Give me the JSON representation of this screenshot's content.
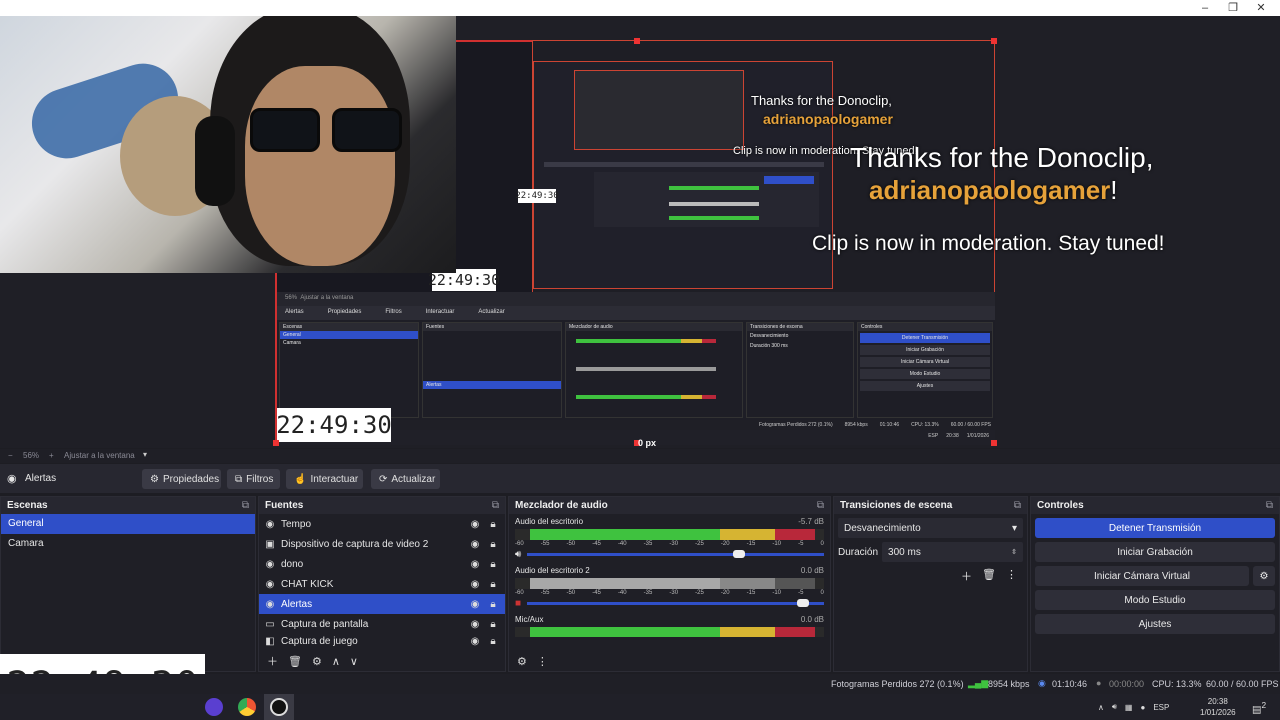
{
  "window": {
    "minimize_glyph": "–",
    "maximize_glyph": "❐",
    "close_glyph": "✕"
  },
  "preview": {
    "clock_time": "22:49:30",
    "zoom_readout": "0 px",
    "donation": {
      "line1": "Thanks for the Donoclip,",
      "username": "adrianopaologamer",
      "exclaim": "!",
      "line2": "Clip is now in moderation. Stay tuned!"
    },
    "mini_clock": "22:49:30",
    "nested_labels": {
      "scenes": "Escenas",
      "sources": "Fuentes",
      "mixer": "Mezclador de audio",
      "transitions": "Transiciones de escena",
      "controls": "Controles",
      "alerts": "Alertas",
      "properties": "Propiedades",
      "filters": "Filtros",
      "interact": "Interactuar",
      "refresh": "Actualizar",
      "general": "General",
      "camera": "Camara",
      "stop_stream": "Detener Transmisión",
      "start_recording": "Iniciar Grabación",
      "virtual_camera": "Iniciar Cámara Virtual",
      "studio_mode": "Modo Estudio",
      "settings": "Ajustes",
      "fade": "Desvanecimiento",
      "duration": "Duración",
      "duration_value": "300 ms",
      "zoom": "56%",
      "fit": "Ajustar a la ventana",
      "status": "Fotogramas Perdidos 272 (0.1%)",
      "bitrate": "8954 kbps",
      "time": "01:10:46",
      "cpu": "CPU: 13.3%",
      "fps": "60.00 / 60.00 FPS",
      "clock_small": "20:38",
      "date_small": "1/01/2026",
      "lang": "ESP",
      "nested_time": "22:49:30",
      "zoom_px": "0 px"
    }
  },
  "zoombar": {
    "minus": "−",
    "zoom": "56%",
    "plus": "+",
    "fit": "Ajustar a la ventana"
  },
  "sourcebar": {
    "current_source": "Alertas",
    "properties": "Propiedades",
    "filters": "Filtros",
    "interact": "Interactuar",
    "refresh": "Actualizar"
  },
  "scenes": {
    "title": "Escenas",
    "items": [
      "General",
      "Camara"
    ]
  },
  "sources": {
    "title": "Fuentes",
    "items": [
      {
        "label": "Tempo",
        "icon": "globe-icon"
      },
      {
        "label": "Dispositivo de captura de video 2",
        "icon": "camera-icon"
      },
      {
        "label": "dono",
        "icon": "globe-icon"
      },
      {
        "label": "CHAT KICK",
        "icon": "globe-icon"
      },
      {
        "label": "Alertas",
        "icon": "globe-icon"
      },
      {
        "label": "Captura de pantalla",
        "icon": "monitor-icon"
      },
      {
        "label": "Captura de juego",
        "icon": "gamepad-icon"
      }
    ]
  },
  "mixer": {
    "title": "Mezclador de audio",
    "channels": [
      {
        "name": "Audio del escritorio",
        "db": "-5.7 dB"
      },
      {
        "name": "Audio del escritorio 2",
        "db": "0.0 dB"
      },
      {
        "name": "Mic/Aux",
        "db": "0.0 dB"
      }
    ],
    "scale": [
      "-60",
      "-55",
      "-50",
      "-45",
      "-40",
      "-35",
      "-30",
      "-25",
      "-20",
      "-15",
      "-10",
      "-5",
      "0"
    ]
  },
  "transitions": {
    "title": "Transiciones de escena",
    "type": "Desvanecimiento",
    "duration_label": "Duración",
    "duration_value": "300 ms"
  },
  "controls": {
    "title": "Controles",
    "stop_stream": "Detener Transmisión",
    "start_recording": "Iniciar Grabación",
    "virtual_camera": "Iniciar Cámara Virtual",
    "studio_mode": "Modo Estudio",
    "settings": "Ajustes"
  },
  "status": {
    "dropped": "Fotogramas Perdidos 272 (0.1%)",
    "bitrate": "8954 kbps",
    "stream_time": "01:10:46",
    "rec_time": "00:00:00",
    "cpu": "CPU: 13.3%",
    "fps": "60.00 / 60.00 FPS"
  },
  "taskbar": {
    "lang": "ESP",
    "time": "20:38",
    "date": "1/01/2026",
    "notif_count": "2"
  },
  "colors": {
    "accent": "#2f4fc8",
    "meter_green": "#3fc23f",
    "meter_yellow": "#d6b432",
    "meter_red": "#b8283a",
    "gold": "#e6a23a",
    "selection_red": "#d03030"
  }
}
